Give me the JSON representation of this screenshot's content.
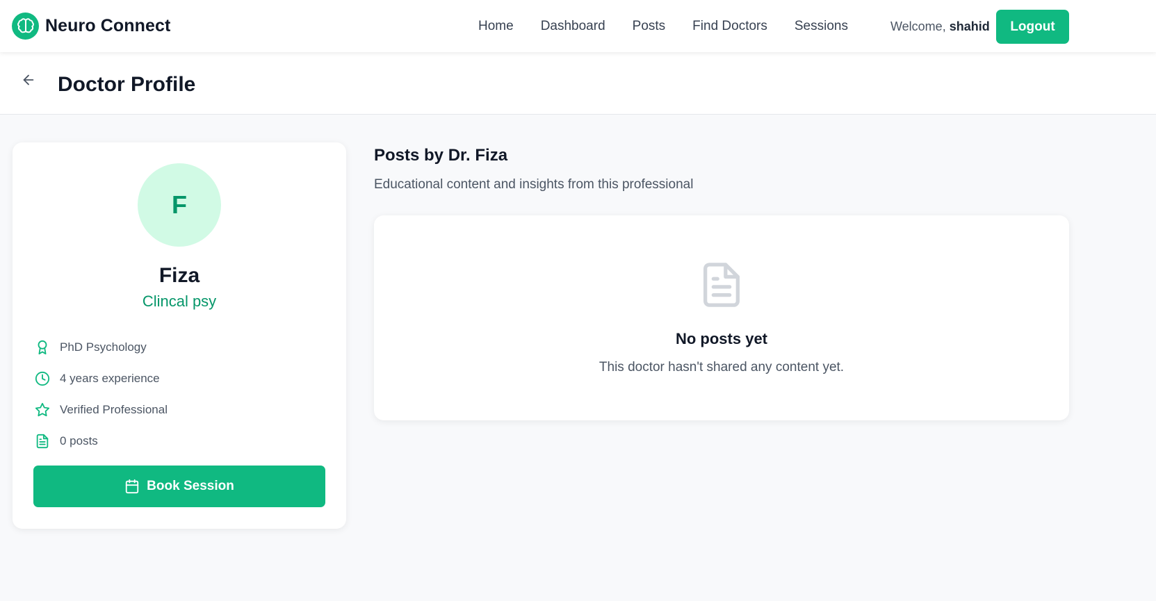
{
  "app": {
    "name": "Neuro Connect",
    "logo_icon": "brain-icon"
  },
  "nav": {
    "links": [
      "Home",
      "Dashboard",
      "Posts",
      "Find Doctors",
      "Sessions"
    ],
    "welcome_prefix": "Welcome,",
    "username": "shahid",
    "logout_label": "Logout"
  },
  "page": {
    "title": "Doctor Profile",
    "back_icon": "arrow-left-icon"
  },
  "doctor": {
    "initial": "F",
    "name": "Fiza",
    "specialty": "Clincal psy",
    "details": [
      {
        "icon": "award-icon",
        "text": "PhD Psychology"
      },
      {
        "icon": "clock-icon",
        "text": "4 years experience"
      },
      {
        "icon": "star-icon",
        "text": "Verified Professional"
      },
      {
        "icon": "document-icon",
        "text": "0 posts"
      }
    ],
    "book_label": "Book Session",
    "book_icon": "calendar-icon"
  },
  "posts": {
    "title": "Posts by Dr. Fiza",
    "subtitle": "Educational content and insights from this professional",
    "empty_icon": "document-icon",
    "empty_title": "No posts yet",
    "empty_message": "This doctor hasn't shared any content yet."
  },
  "colors": {
    "accent": "#10b981",
    "accent_dark": "#059669",
    "avatar_bg": "#d1fae5",
    "page_bg": "#f8f9fb"
  }
}
